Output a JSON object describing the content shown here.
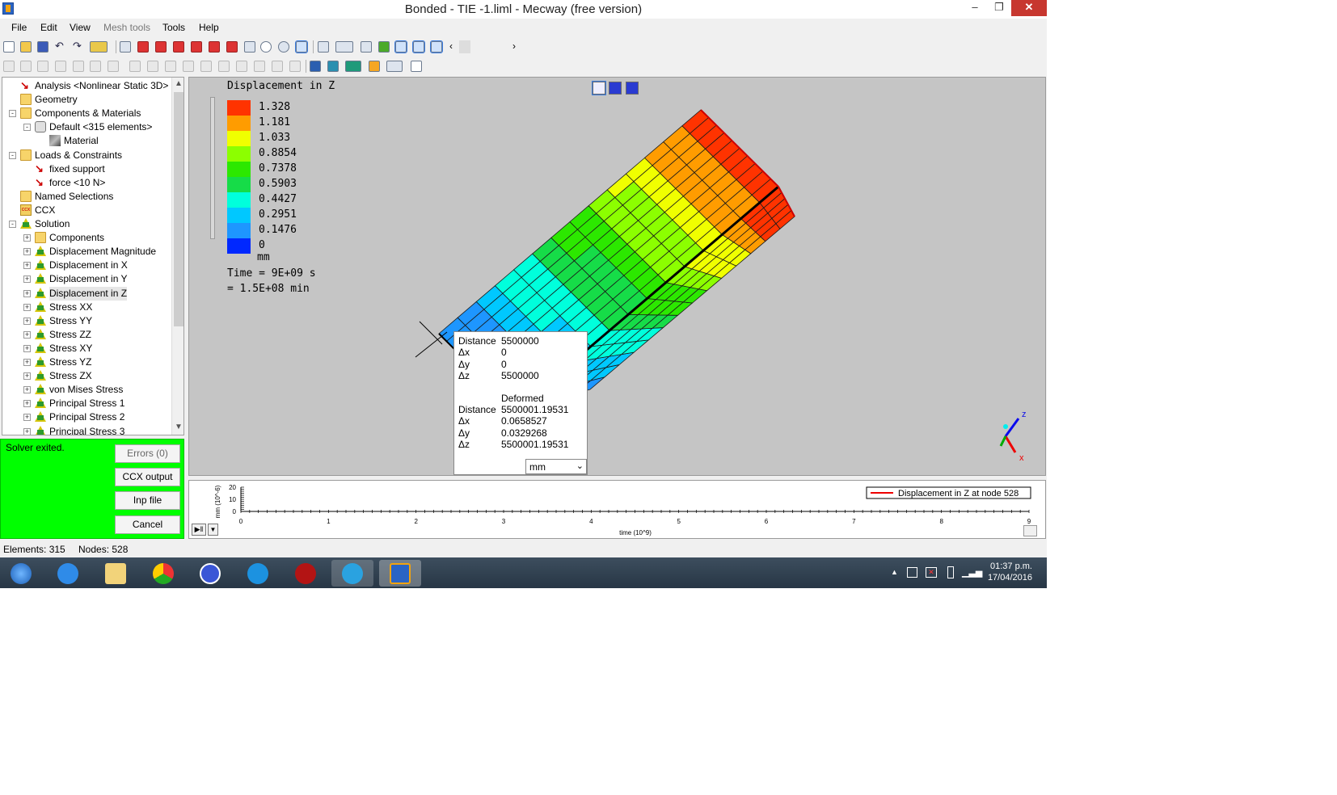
{
  "window": {
    "title": "Bonded - TIE -1.liml - Mecway (free version)"
  },
  "menu": [
    "File",
    "Edit",
    "View",
    "Mesh tools",
    "Tools",
    "Help"
  ],
  "tree": [
    {
      "label": "Analysis <Nonlinear Static 3D>",
      "icon": "analysis-icon"
    },
    {
      "label": "Geometry",
      "icon": "folder-icon"
    },
    {
      "label": "Components & Materials",
      "icon": "components-icon"
    },
    {
      "label": "Default <315 elements>",
      "icon": "component-icon"
    },
    {
      "label": "Material",
      "icon": "material-icon"
    },
    {
      "label": "Loads & Constraints",
      "icon": "loads-icon"
    },
    {
      "label": "fixed support",
      "icon": "fixed-support-icon"
    },
    {
      "label": "force <10 N>",
      "icon": "force-icon"
    },
    {
      "label": "Named Selections",
      "icon": "named-selections-icon"
    },
    {
      "label": "CCX",
      "icon": "ccx-icon"
    },
    {
      "label": "Solution",
      "icon": "solution-icon"
    },
    {
      "label": "Components",
      "icon": "components-icon"
    },
    {
      "label": "Displacement Magnitude",
      "icon": "result-icon"
    },
    {
      "label": "Displacement in X",
      "icon": "result-icon"
    },
    {
      "label": "Displacement in Y",
      "icon": "result-icon"
    },
    {
      "label": "Displacement in Z",
      "icon": "result-icon"
    },
    {
      "label": "Stress XX",
      "icon": "result-icon"
    },
    {
      "label": "Stress YY",
      "icon": "result-icon"
    },
    {
      "label": "Stress ZZ",
      "icon": "result-icon"
    },
    {
      "label": "Stress XY",
      "icon": "result-icon"
    },
    {
      "label": "Stress YZ",
      "icon": "result-icon"
    },
    {
      "label": "Stress ZX",
      "icon": "result-icon"
    },
    {
      "label": "von Mises Stress",
      "icon": "result-icon"
    },
    {
      "label": "Principal Stress 1",
      "icon": "result-icon"
    },
    {
      "label": "Principal Stress 2",
      "icon": "result-icon"
    },
    {
      "label": "Principal Stress 3",
      "icon": "result-icon"
    }
  ],
  "solver": {
    "status": "Solver exited.",
    "buttons": [
      "Errors (0)",
      "CCX output",
      "Inp file",
      "Cancel"
    ]
  },
  "legend": {
    "title": "Displacement in Z",
    "values": [
      "1.328",
      "1.181",
      "1.033",
      "0.8854",
      "0.7378",
      "0.5903",
      "0.4427",
      "0.2951",
      "0.1476",
      "0"
    ],
    "colors": [
      "#ff3300",
      "#ff9c00",
      "#f0ff00",
      "#8cff00",
      "#2ce800",
      "#16dc48",
      "#00ffdc",
      "#00c8ff",
      "#1e96ff",
      "#0028ff"
    ],
    "unit": "mm",
    "time_line1": "Time = 9E+09 s",
    "time_line2": "= 1.5E+08 min"
  },
  "measure_popup": {
    "rows": [
      [
        "Distance",
        "5500000"
      ],
      [
        "Δx",
        "0"
      ],
      [
        "Δy",
        "0"
      ],
      [
        "Δz",
        "5500000"
      ]
    ],
    "deformed_header": "Deformed",
    "deformed_rows": [
      [
        "Distance",
        "5500001.19531"
      ],
      [
        "Δx",
        "0.0658527"
      ],
      [
        "Δy",
        "0.0329268"
      ],
      [
        "Δz",
        "5500001.19531"
      ]
    ],
    "unit_select": "mm"
  },
  "triad": {
    "x": "x",
    "z": "z"
  },
  "graph": {
    "ylabel": "mm (10^-6)",
    "yticks": [
      "20",
      "10",
      "0"
    ],
    "xticks": [
      "0",
      "1",
      "2",
      "3",
      "4",
      "5",
      "6",
      "7",
      "8",
      "9"
    ],
    "xlabel": "time (10^9)",
    "legend": "Displacement in Z at node 528"
  },
  "status": {
    "elements": "Elements:  315",
    "nodes": "Nodes: 528"
  },
  "clock": {
    "time": "01:37 p.m.",
    "date": "17/04/2016"
  }
}
